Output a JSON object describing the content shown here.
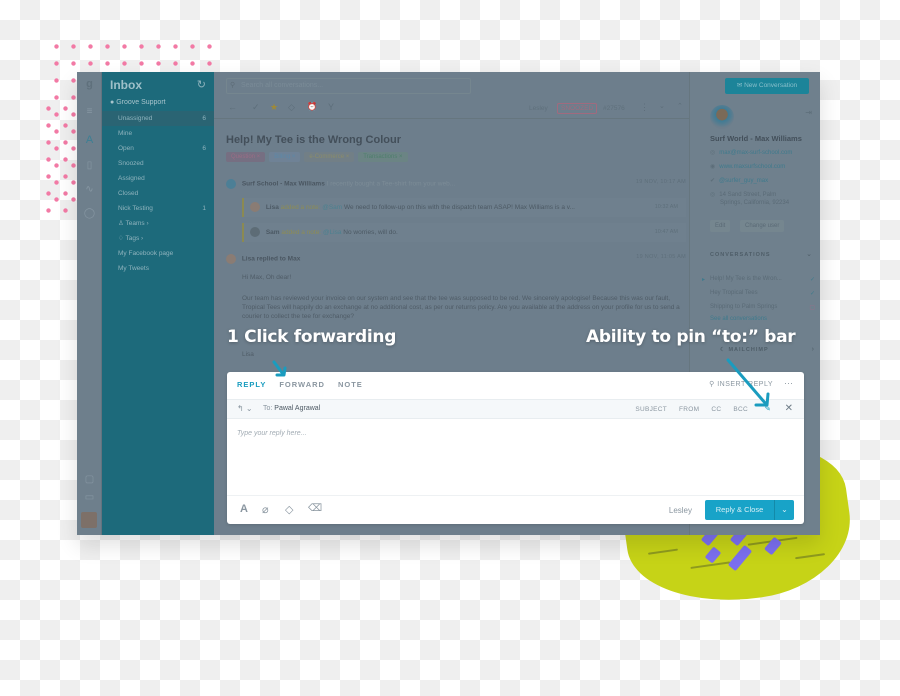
{
  "colors": {
    "accent": "#1a9cbf",
    "folder_panel": "#1d6a7b",
    "overlay": "#6c7d8b",
    "blob": "#c6d317",
    "slash": "#7b6ff0",
    "dots": "#f27aa5"
  },
  "icons": {
    "logo": "groove-logo-icon",
    "hamburger": "menu-icon",
    "inbox": "inbox-icon",
    "book": "knowledge-base-icon",
    "pulse": "activity-icon",
    "chat": "chat-icon",
    "settings": "settings-icon",
    "card": "billing-icon",
    "user": "user-avatar"
  },
  "sidebar": {
    "title": "Inbox",
    "refresh_glyph": "↻",
    "group": "Groove Support",
    "items": [
      {
        "label": "Unassigned",
        "count": "6",
        "active": true
      },
      {
        "label": "Mine",
        "count": ""
      },
      {
        "label": "Open",
        "count": "6"
      },
      {
        "label": "Snoozed",
        "count": ""
      },
      {
        "label": "Assigned",
        "count": ""
      },
      {
        "label": "Closed",
        "count": ""
      },
      {
        "label": "Nick Testing",
        "count": "1"
      },
      {
        "label": "♙ Teams ›",
        "count": ""
      },
      {
        "label": "♢ Tags ›",
        "count": ""
      },
      {
        "label": "My Facebook page",
        "count": ""
      },
      {
        "label": "My Tweets",
        "count": ""
      }
    ]
  },
  "search": {
    "placeholder": "Search all conversations..."
  },
  "toolbar": {
    "back": "←",
    "check": "✓",
    "star": "★",
    "tag": "⌂",
    "snooze": "⏰",
    "merge": "Y",
    "assignee": "Lesley",
    "status": "SNOOZED",
    "ticket": "#27576",
    "more": "⋮",
    "down": "⌄",
    "up": "⌃"
  },
  "conversation": {
    "subject": "Help! My Tee is the Wrong Colour",
    "tags": [
      {
        "label": "Question ×",
        "bg": "#766f82",
        "fg": "#9a6c85"
      },
      {
        "label": "Billing ×",
        "bg": "#6f8296",
        "fg": "#5c88a8"
      },
      {
        "label": "e-Commerce ×",
        "bg": "#727f86",
        "fg": "#8a8c6b"
      },
      {
        "label": "Transactions ×",
        "bg": "#6b8484",
        "fg": "#4e7f6c"
      }
    ],
    "first_message": {
      "author": "Surf School - Max Williams",
      "preview": "I recently bought a Tee-shirt from your web...",
      "time": "19 NOV, 10:17 AM"
    },
    "notes": [
      {
        "author": "Lisa",
        "action": "added a note:",
        "mention": "@Sam",
        "text": "We need to follow-up on this with the dispatch team ASAP! Max Williams is a v...",
        "time": "10:32 AM"
      },
      {
        "author": "Sam",
        "action": "added a note:",
        "mention": "@Lisa",
        "text": "No worries, will do.",
        "time": "10:47 AM"
      }
    ],
    "reply_message": {
      "header": "Lisa replied to Max",
      "time": "19 NOV, 11:05 AM",
      "greeting": "Hi Max, Oh dear!",
      "body": "Our team has reviewed your invoice on our system and see that the tee was supposed to be red. We sincerely apologise! Because this was our fault, Tropical Tees will happily do an exchange at no additional cost, as per our returns policy. Are you available at the address on your profile for us to send a courier to collect the tee for exchange?",
      "signature": "Lisa"
    }
  },
  "customer": {
    "new_conversation": "✉ New Conversation",
    "exit_glyph": "⇥",
    "name": "Surf World - Max Williams",
    "email": "max@max-surf-school.com",
    "website": "www.maxsurfschool.com",
    "twitter": "@surfer_guy_max",
    "address_line1": "14 Sand Street, Palm",
    "address_line2": "Springs, California, 92234",
    "edit_label": "Edit",
    "change_user_label": "Change user",
    "conversations_header": "CONVERSATIONS",
    "conversations": [
      {
        "title": "Help! My Tee is the Wron...",
        "status": "✓",
        "status_color": "#3f7a8d",
        "current": true
      },
      {
        "title": "Hey Tropical Tees",
        "status": "✓",
        "status_color": "#3f7a8d"
      },
      {
        "title": "Shipping to Palm Springs",
        "status": "▢",
        "status_color": "#96708a"
      }
    ],
    "see_all": "See all conversations",
    "integration": "MAILCHIMP"
  },
  "composer": {
    "tabs": [
      {
        "label": "REPLY",
        "active": true
      },
      {
        "label": "FORWARD",
        "active": false
      },
      {
        "label": "NOTE",
        "active": false
      }
    ],
    "insert_reply": "⚲ INSERT REPLY",
    "more": "···",
    "reply_glyph": "↰ ⌄",
    "to_label": "To:",
    "to_value": "Pawal Agrawal",
    "fields": [
      "SUBJECT",
      "FROM",
      "CC",
      "BCC"
    ],
    "pin_glyph": "📌",
    "close_glyph": "✕",
    "placeholder": "Type your reply here...",
    "footer_icons": {
      "format": "A",
      "attach": "⊘",
      "tag": "◇",
      "trash": "🗑"
    },
    "agent": "Lesley",
    "send_label": "Reply & Close",
    "send_chevron": "⌄"
  },
  "callouts": {
    "left": "1 Click forwarding",
    "right": "Ability to pin “to:” bar"
  }
}
